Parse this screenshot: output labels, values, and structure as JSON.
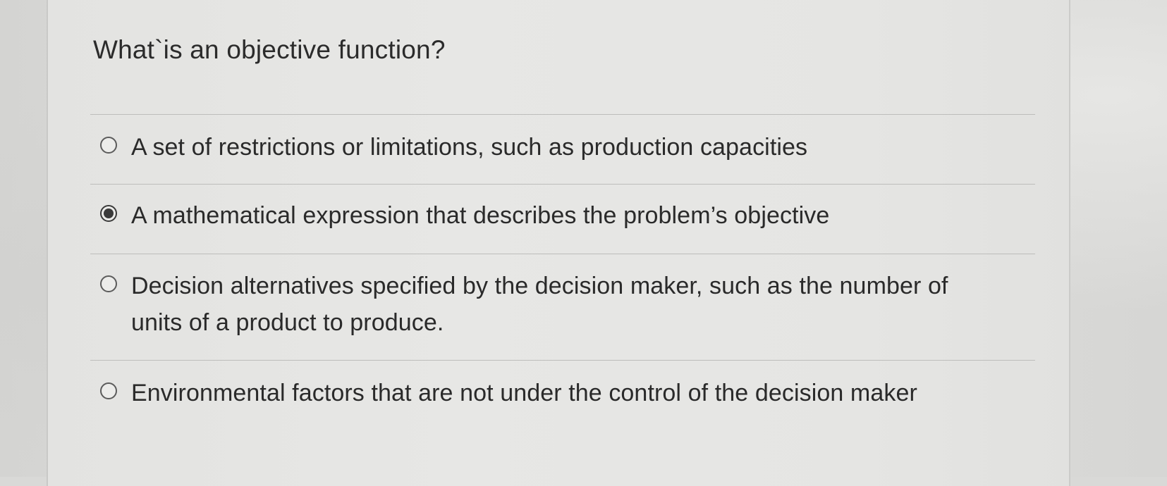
{
  "question": {
    "text": "What`is an objective function?"
  },
  "options": [
    {
      "label": "A set of restrictions or limitations, such as production capacities",
      "selected": false
    },
    {
      "label": "A mathematical expression that describes the problem’s objective",
      "selected": true
    },
    {
      "label": "Decision alternatives specified by the decision maker, such as the number of units of a product to produce.",
      "selected": false
    },
    {
      "label": "Environmental factors that are not under the control of the decision maker",
      "selected": false
    }
  ]
}
